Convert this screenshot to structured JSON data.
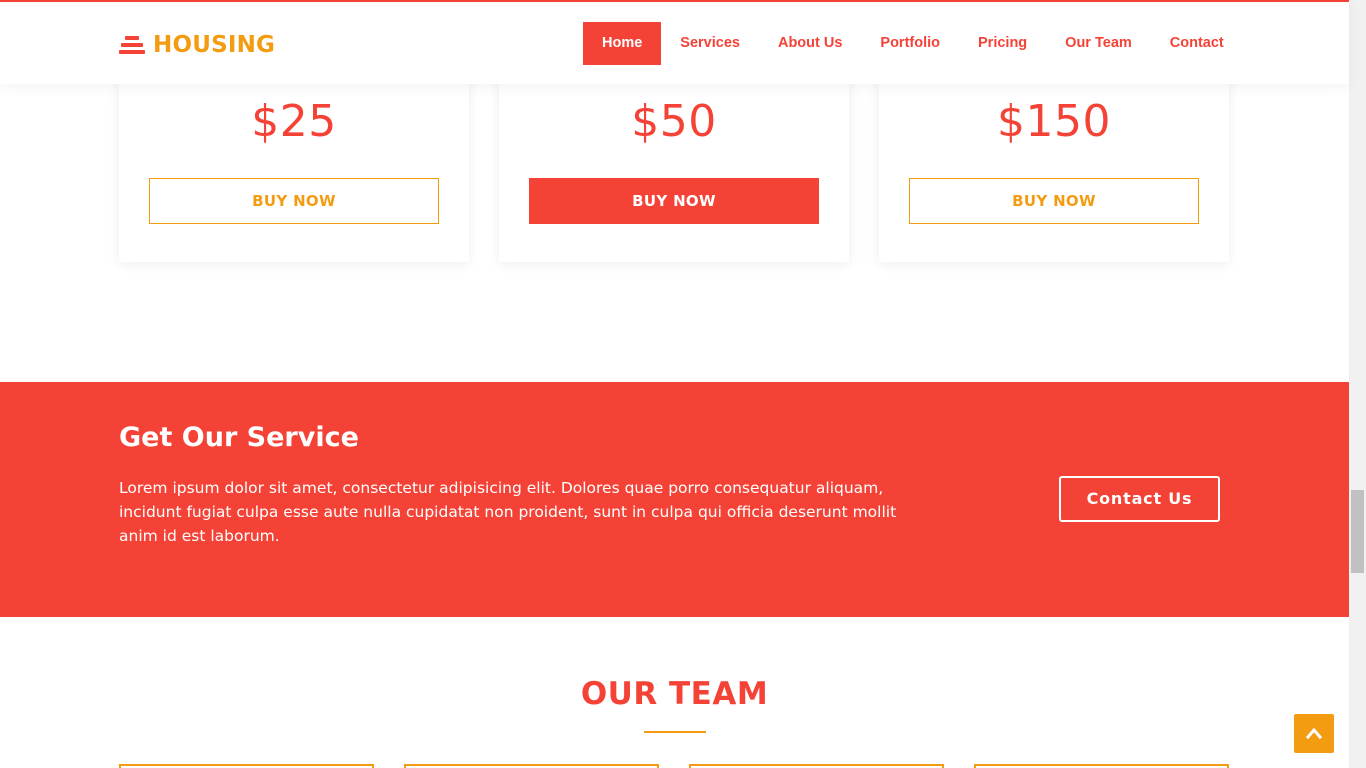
{
  "header": {
    "logo_text": "HOUSING",
    "logo_icon": "stacked-bars-icon",
    "nav": [
      {
        "label": "Home",
        "active": true
      },
      {
        "label": "Services"
      },
      {
        "label": "About Us"
      },
      {
        "label": "Portfolio"
      },
      {
        "label": "Pricing"
      },
      {
        "label": "Our Team"
      },
      {
        "label": "Contact"
      }
    ]
  },
  "pricing": {
    "cards": [
      {
        "price": "$25",
        "button": "BUY NOW",
        "featured": false
      },
      {
        "price": "$50",
        "button": "BUY NOW",
        "featured": true
      },
      {
        "price": "$150",
        "button": "BUY NOW",
        "featured": false
      }
    ]
  },
  "service": {
    "title": "Get Our Service",
    "text": "Lorem ipsum dolor sit amet, consectetur adipisicing elit. Dolores quae porro consequatur aliquam, incidunt fugiat culpa esse aute nulla cupidatat non proident, sunt in culpa qui officia deserunt mollit anim id est laborum.",
    "button": "Contact Us"
  },
  "team": {
    "title": "OUR TEAM"
  },
  "back_to_top_icon": "chevron-up-icon",
  "colors": {
    "primary": "#f44336",
    "accent": "#f39c12",
    "background": "#ffffff"
  }
}
